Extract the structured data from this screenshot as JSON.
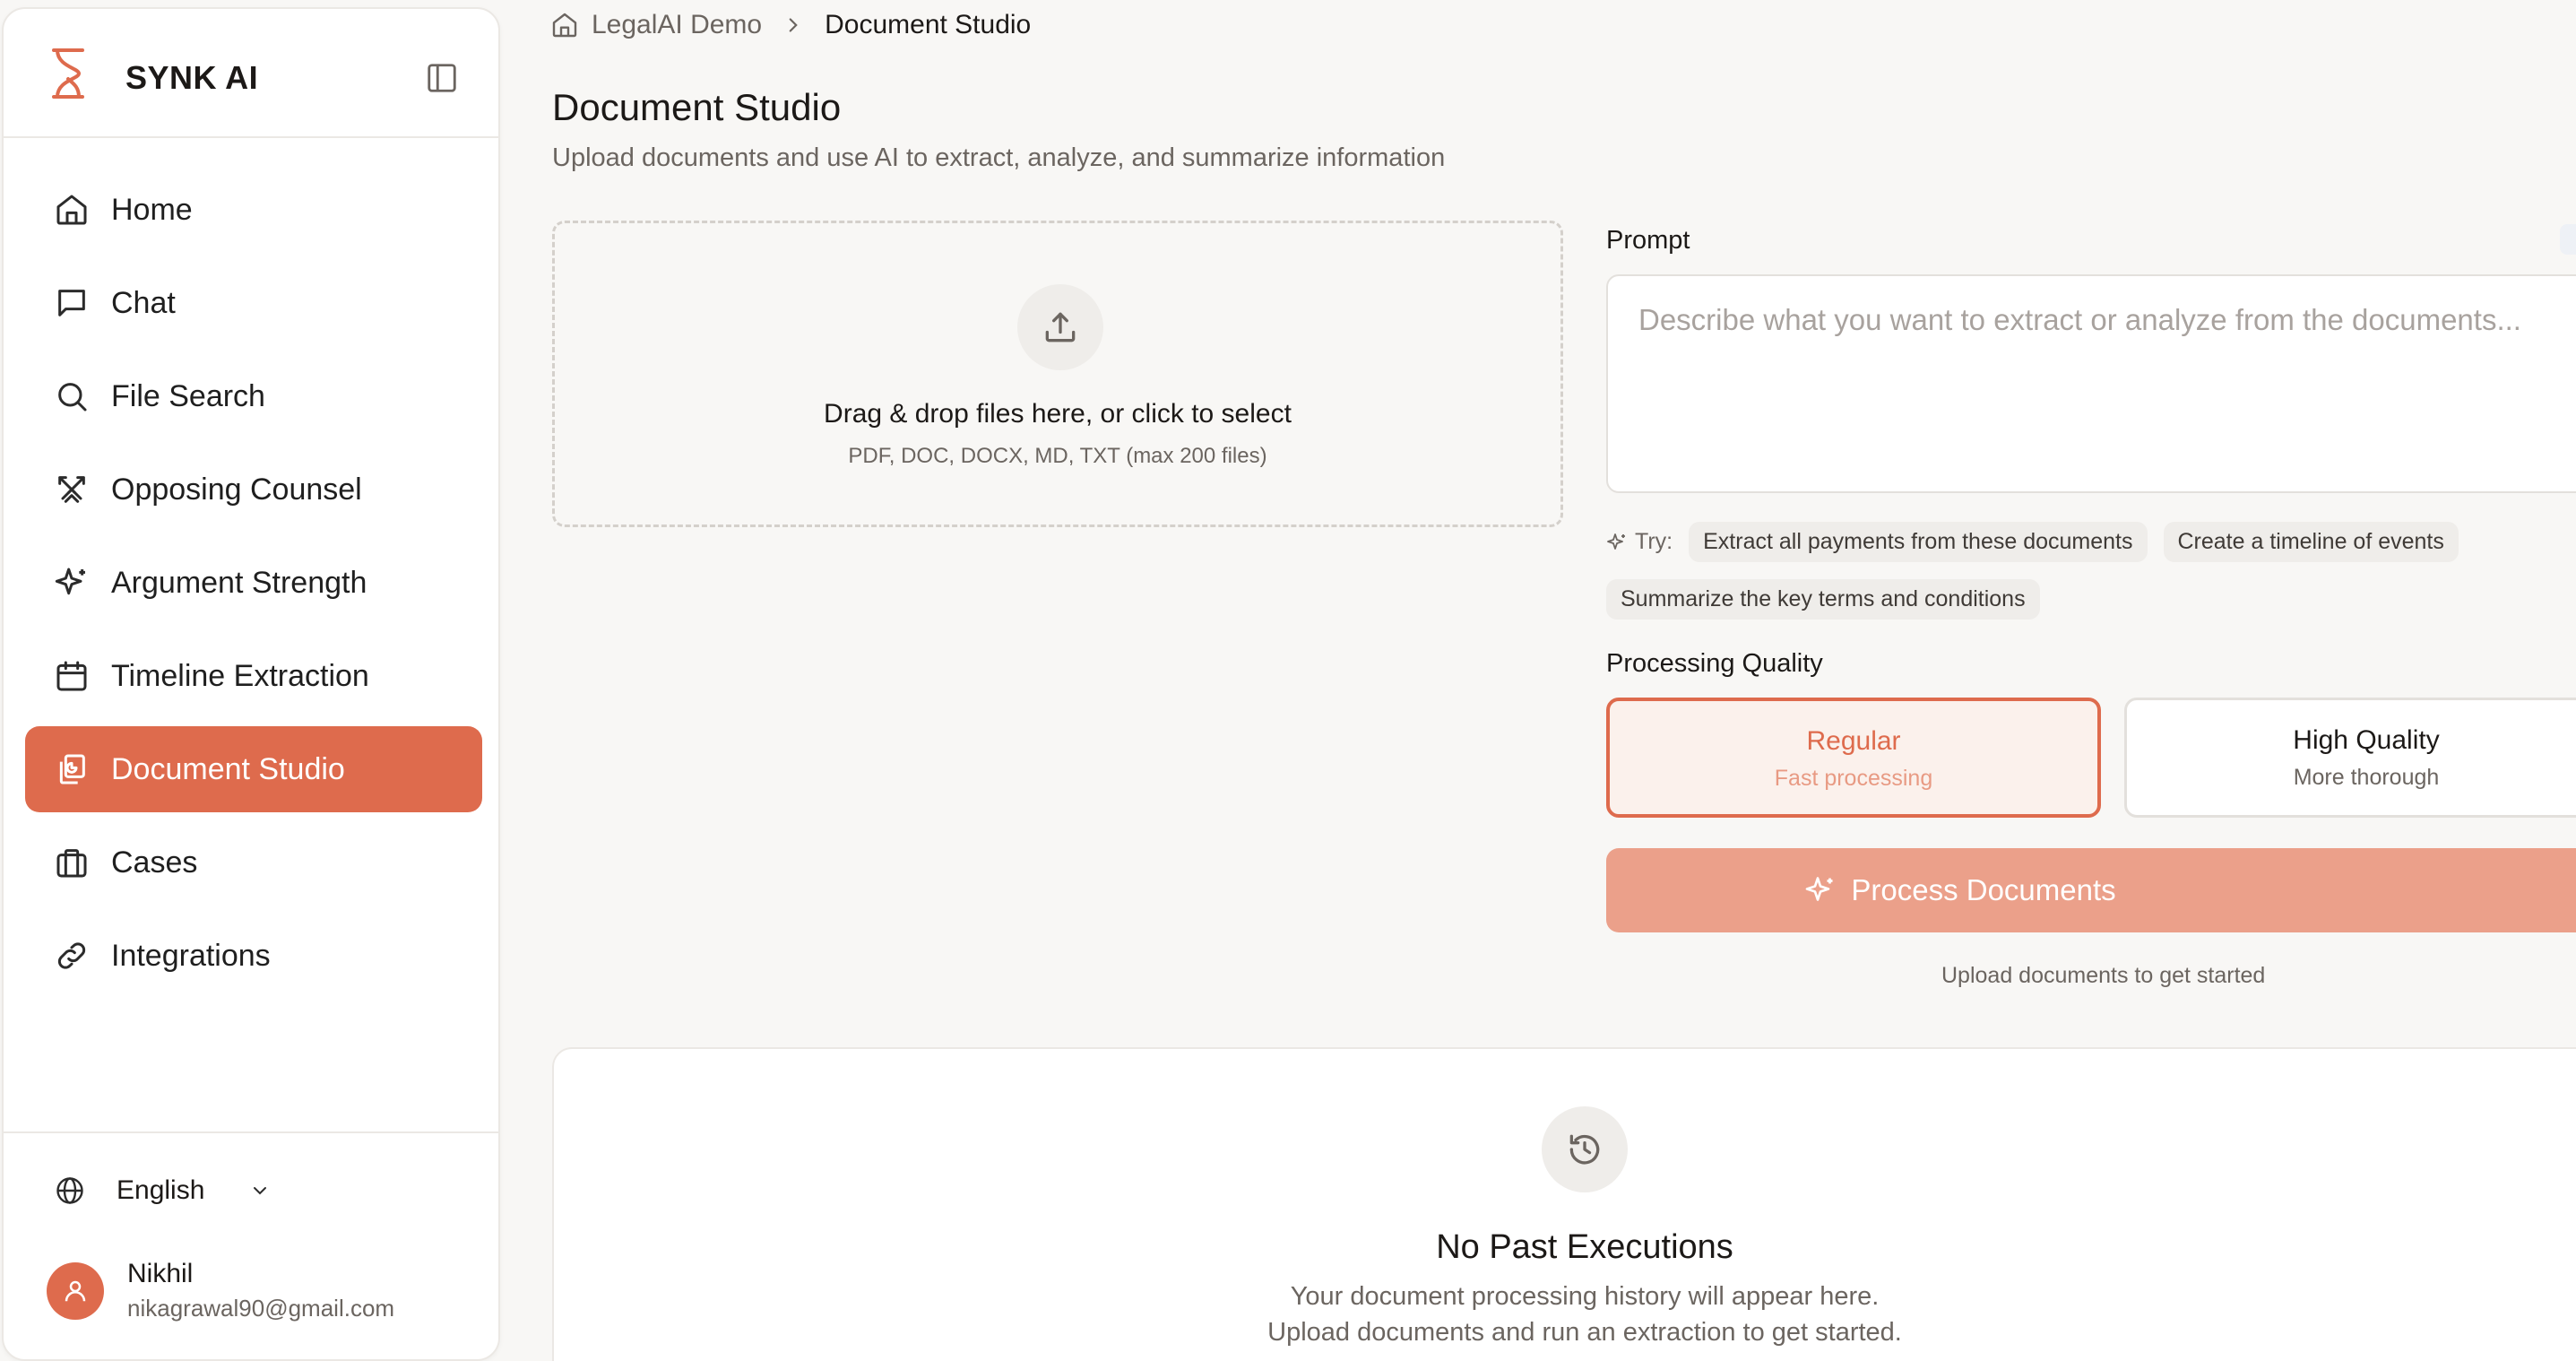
{
  "sidebar": {
    "brand": "SYNK AI",
    "items": [
      {
        "label": "Home",
        "icon": "home-icon"
      },
      {
        "label": "Chat",
        "icon": "chat-icon"
      },
      {
        "label": "File Search",
        "icon": "search-icon"
      },
      {
        "label": "Opposing Counsel",
        "icon": "swords-icon"
      },
      {
        "label": "Argument Strength",
        "icon": "sparkles-icon"
      },
      {
        "label": "Timeline Extraction",
        "icon": "calendar-icon"
      },
      {
        "label": "Document Studio",
        "icon": "documents-icon",
        "active": true
      },
      {
        "label": "Cases",
        "icon": "briefcase-icon"
      },
      {
        "label": "Integrations",
        "icon": "link-icon"
      }
    ],
    "language": "English",
    "user": {
      "name": "Nikhil",
      "email": "nikagrawal90@gmail.com"
    }
  },
  "breadcrumb": {
    "root": "LegalAI Demo",
    "current": "Document Studio"
  },
  "page": {
    "title": "Document Studio",
    "subtitle": "Upload documents and use AI to extract, analyze, and summarize information"
  },
  "dropzone": {
    "title": "Drag & drop files here, or click to select",
    "types": "PDF, DOC, DOCX, MD, TXT (max 200 files)"
  },
  "prompt": {
    "label": "Prompt",
    "placeholder": "Describe what you want to extract or analyze from the documents...",
    "value": "",
    "try_label": "Try:",
    "suggestions": [
      "Extract all payments from these documents",
      "Create a timeline of events",
      "Summarize the key terms and conditions"
    ]
  },
  "quality": {
    "label": "Processing Quality",
    "options": [
      {
        "name": "Regular",
        "desc": "Fast processing",
        "selected": true
      },
      {
        "name": "High Quality",
        "desc": "More thorough",
        "selected": false
      }
    ]
  },
  "process": {
    "label": "Process Documents",
    "helper": "Upload documents to get started"
  },
  "history": {
    "title": "No Past Executions",
    "line1": "Your document processing history will appear here.",
    "line2": "Upload documents and run an extraction to get started."
  },
  "colors": {
    "accent": "#de6b4d",
    "accent_light": "#eba08a",
    "background": "#f8f7f5"
  }
}
